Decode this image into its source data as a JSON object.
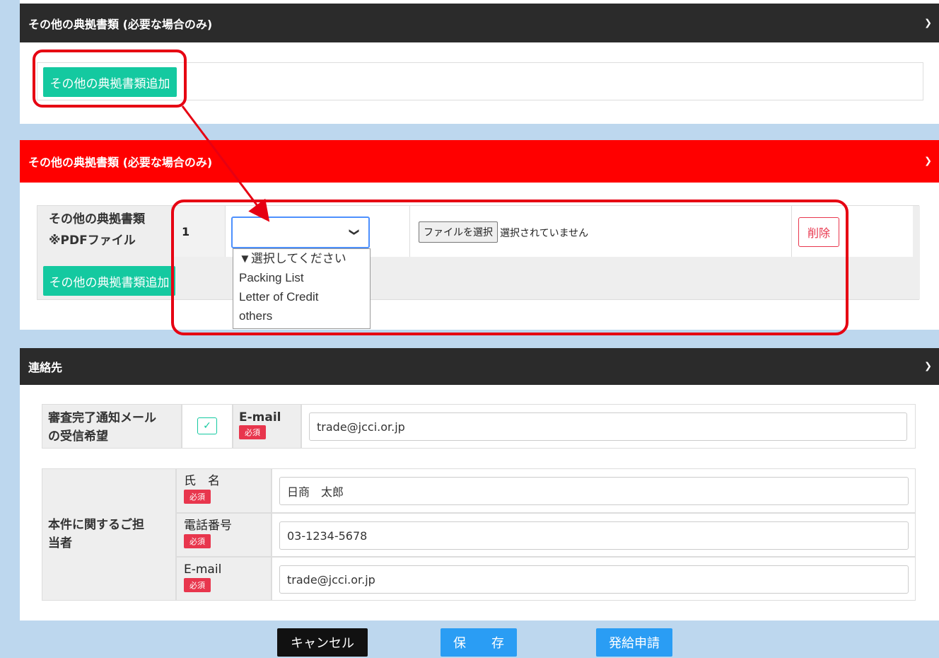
{
  "section1": {
    "title": "その他の典拠書類 (必要な場合のみ)",
    "add_button": "その他の典拠書類追加"
  },
  "section2": {
    "title": "その他の典拠書類 (必要な場合のみ)",
    "row_label_line1": "その他の典拠書類",
    "row_label_line2": "※PDFファイル",
    "row_number": "1",
    "file_button": "ファイルを選択",
    "file_status": "選択されていません",
    "delete_button": "削除",
    "add_button": "その他の典拠書類追加",
    "dropdown_options": [
      "▼選択してください",
      "Packing List",
      "Letter of Credit",
      "others"
    ]
  },
  "contact": {
    "title": "連絡先",
    "notify_label_line1": "審査完了通知メール",
    "notify_label_line2": "の受信希望",
    "email_label": "E-mail",
    "required": "必須",
    "email_value": "trade@jcci.or.jp",
    "person_label_line1": "本件に関するご担",
    "person_label_line2": "当者",
    "name_label": "氏　名",
    "name_value": "日商　太郎",
    "phone_label": "電話番号",
    "phone_value": "03-1234-5678",
    "email2_label": "E-mail",
    "email2_value": "trade@jcci.or.jp"
  },
  "footer": {
    "cancel": "キャンセル",
    "save": "保　　存",
    "apply": "発給申請"
  },
  "colors": {
    "dark_header": "#2b2b2b",
    "red_header": "#ff0000",
    "green_button": "#14c9a0",
    "blue_button": "#2a9df4",
    "required_badge": "#e8364d",
    "annotation_red": "#e60012"
  }
}
